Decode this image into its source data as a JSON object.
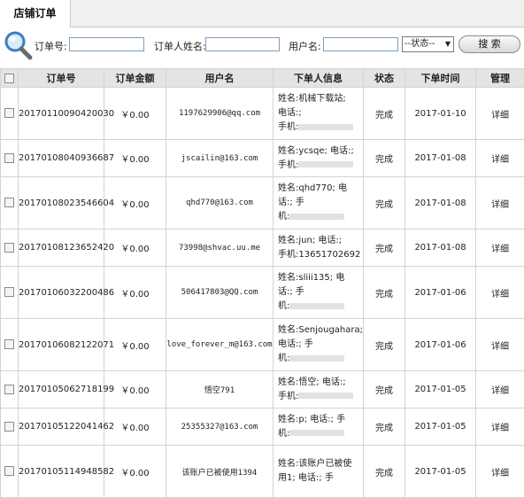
{
  "tab": {
    "label": "店铺订单"
  },
  "search": {
    "order_no_label": "订单号:",
    "buyer_name_label": "订单人姓名:",
    "username_label": "用户名:",
    "status_select": "--状态--",
    "search_button": "搜 索"
  },
  "table": {
    "headers": [
      "订单号",
      "订单金额",
      "用户名",
      "下单人信息",
      "状态",
      "下单时间",
      "管理"
    ],
    "rows": [
      {
        "order_no": "20170110090420030",
        "amount": "￥0.00",
        "username": "1197629906@qq.com",
        "info": [
          "姓名:机械下载站;",
          "电话:;",
          "手机:"
        ],
        "status": "完成",
        "date": "2017-01-10",
        "action": "详细"
      },
      {
        "order_no": "20170108040936687",
        "amount": "￥0.00",
        "username": "jscailin@163.com",
        "info": [
          "姓名:ycsqe; 电话:;",
          "手机:"
        ],
        "status": "完成",
        "date": "2017-01-08",
        "action": "详细"
      },
      {
        "order_no": "20170108023546604",
        "amount": "￥0.00",
        "username": "qhd770@163.com",
        "info": [
          "姓名:qhd770; 电",
          "话:; 手",
          "机:"
        ],
        "status": "完成",
        "date": "2017-01-08",
        "action": "详细"
      },
      {
        "order_no": "20170108123652420",
        "amount": "￥0.00",
        "username": "73998@shvac.uu.me",
        "info": [
          "姓名:jun; 电话:;",
          "手机:13651702692"
        ],
        "status": "完成",
        "date": "2017-01-08",
        "action": "详细"
      },
      {
        "order_no": "20170106032200486",
        "amount": "￥0.00",
        "username": "506417803@QQ.com",
        "info": [
          "姓名:sliii135; 电",
          "话:; 手",
          "机:"
        ],
        "status": "完成",
        "date": "2017-01-06",
        "action": "详细"
      },
      {
        "order_no": "20170106082122071",
        "amount": "￥0.00",
        "username": "love_forever_m@163.com",
        "info": [
          "姓名:Senjougahara;",
          "电话:; 手",
          "机:"
        ],
        "status": "完成",
        "date": "2017-01-06",
        "action": "详细"
      },
      {
        "order_no": "20170105062718199",
        "amount": "￥0.00",
        "username": "悟空791",
        "info": [
          "姓名:悟空; 电话:;",
          "手机:"
        ],
        "status": "完成",
        "date": "2017-01-05",
        "action": "详细"
      },
      {
        "order_no": "20170105122041462",
        "amount": "￥0.00",
        "username": "25355327@163.com",
        "info": [
          "姓名:p; 电话:; 手",
          "机:"
        ],
        "status": "完成",
        "date": "2017-01-05",
        "action": "详细"
      },
      {
        "order_no": "20170105114948582",
        "amount": "￥0.00",
        "username": "该账户已被使用1394",
        "info": [
          "姓名:该账户已被使",
          "用1; 电话:; 手"
        ],
        "status": "完成",
        "date": "2017-01-05",
        "action": "详细"
      }
    ]
  }
}
